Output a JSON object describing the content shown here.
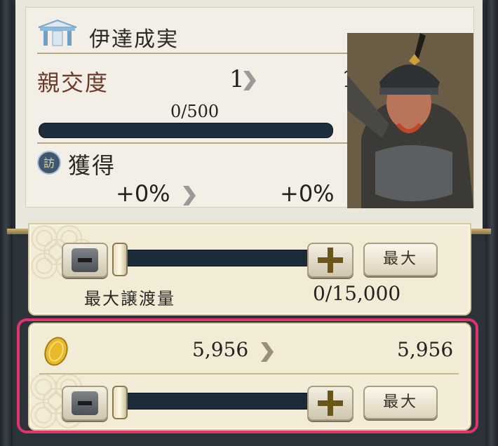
{
  "officer": {
    "name": "伊達成実",
    "affinity_label": "親交度",
    "affinity_from": "1",
    "affinity_to": "1",
    "progress_text": "0/500",
    "progress_fraction": 0,
    "gain_label": "獲得",
    "gain_icon_glyph": "訪",
    "gain_from": "+0%",
    "gain_to": "+0%"
  },
  "transfer": {
    "label": "最大譲渡量",
    "value": "0/15,000",
    "max_button": "最大"
  },
  "gold": {
    "from": "5,956",
    "to": "5,956",
    "max_button": "最大"
  },
  "colors": {
    "highlight": "#e2336b",
    "track": "#1b2b3a",
    "accent_gold": "#d9b65a"
  },
  "icons": [
    "house-icon",
    "chevron-right-icon",
    "gain-badge-icon",
    "gold-coin-icon",
    "minus-icon",
    "plus-icon"
  ]
}
